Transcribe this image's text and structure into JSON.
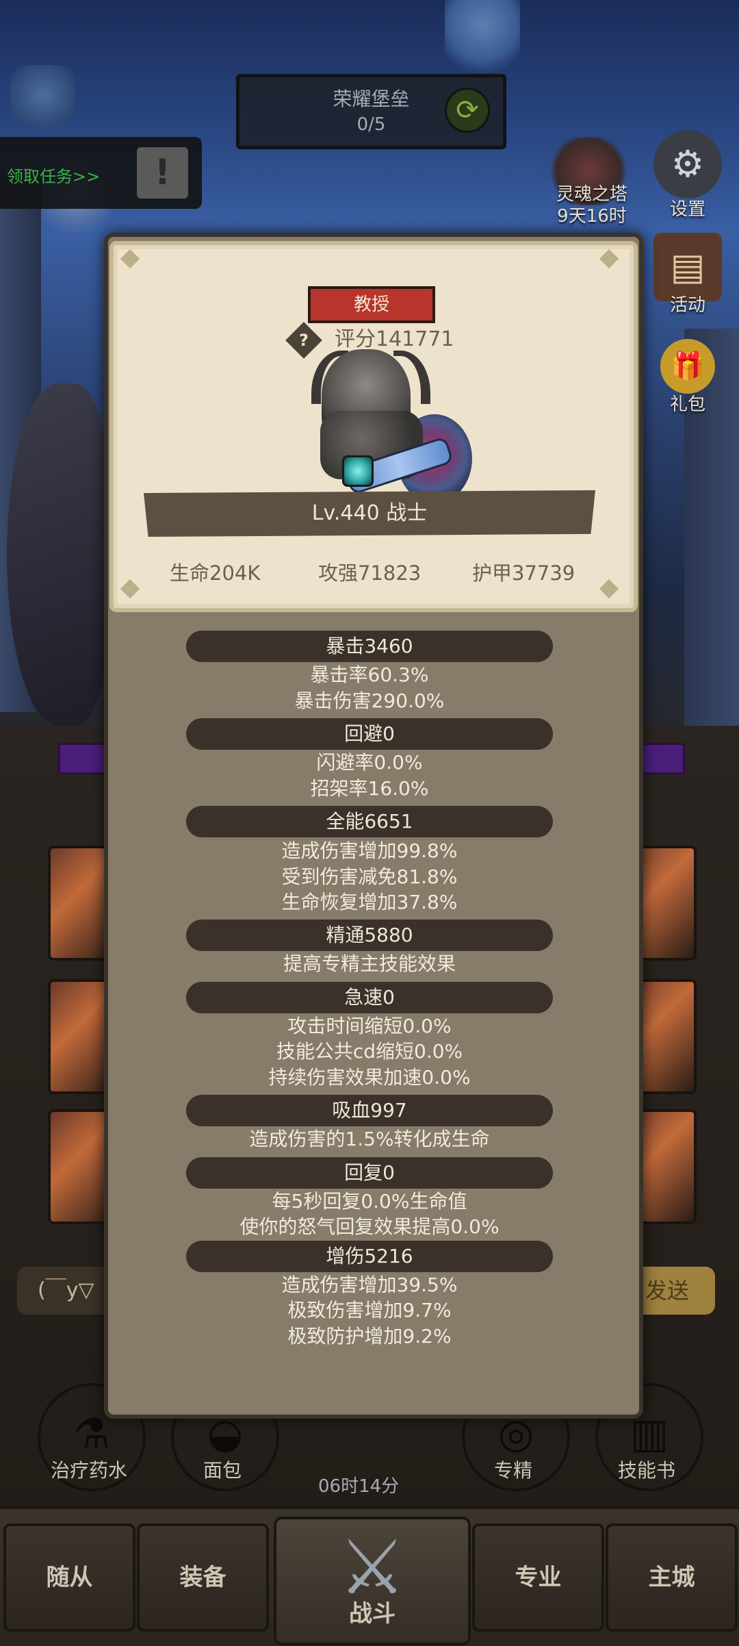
{
  "top": {
    "banner_title": "荣耀堡垒",
    "banner_progress": "0/5",
    "quest_label": "领取任务>>",
    "soul_tower_label": "灵魂之塔",
    "soul_tower_timer": "9天16时",
    "settings_label": "设置",
    "activity_label": "活动",
    "gift_label": "礼包"
  },
  "hero": {
    "rank_label": "教授",
    "score_text": "评分141771",
    "level_text": "Lv.440 战士",
    "hp_text": "生命204K",
    "atk_text": "攻强71823",
    "armor_text": "护甲37739"
  },
  "stats": [
    {
      "head": "暴击3460",
      "lines": [
        "暴击率60.3%",
        "暴击伤害290.0%"
      ]
    },
    {
      "head": "回避0",
      "lines": [
        "闪避率0.0%",
        "招架率16.0%"
      ]
    },
    {
      "head": "全能6651",
      "lines": [
        "造成伤害增加99.8%",
        "受到伤害减免81.8%",
        "生命恢复增加37.8%"
      ]
    },
    {
      "head": "精通5880",
      "lines": [
        "提高专精主技能效果"
      ]
    },
    {
      "head": "急速0",
      "lines": [
        "攻击时间缩短0.0%",
        "技能公共cd缩短0.0%",
        "持续伤害效果加速0.0%"
      ]
    },
    {
      "head": "吸血997",
      "lines": [
        "造成伤害的1.5%转化成生命"
      ]
    },
    {
      "head": "回复0",
      "lines": [
        "每5秒回复0.0%生命值",
        "使你的怒气回复效果提高0.0%"
      ]
    },
    {
      "head": "增伤5216",
      "lines": [
        "造成伤害增加39.5%",
        "极致伤害增加9.7%",
        "极致防护增加9.2%"
      ]
    }
  ],
  "chat": {
    "input_text": "(￣y▽",
    "send_label": "发送"
  },
  "consumables": [
    {
      "label": "治疗药水",
      "icon": "potion-icon"
    },
    {
      "label": "面包",
      "icon": "bread-icon"
    },
    {
      "label": "专精",
      "icon": "spec-icon"
    },
    {
      "label": "技能书",
      "icon": "skillbook-icon"
    }
  ],
  "timer_text": "06时14分",
  "nav": {
    "followers": "随从",
    "equipment": "装备",
    "battle": "战斗",
    "profession": "专业",
    "city": "主城"
  }
}
